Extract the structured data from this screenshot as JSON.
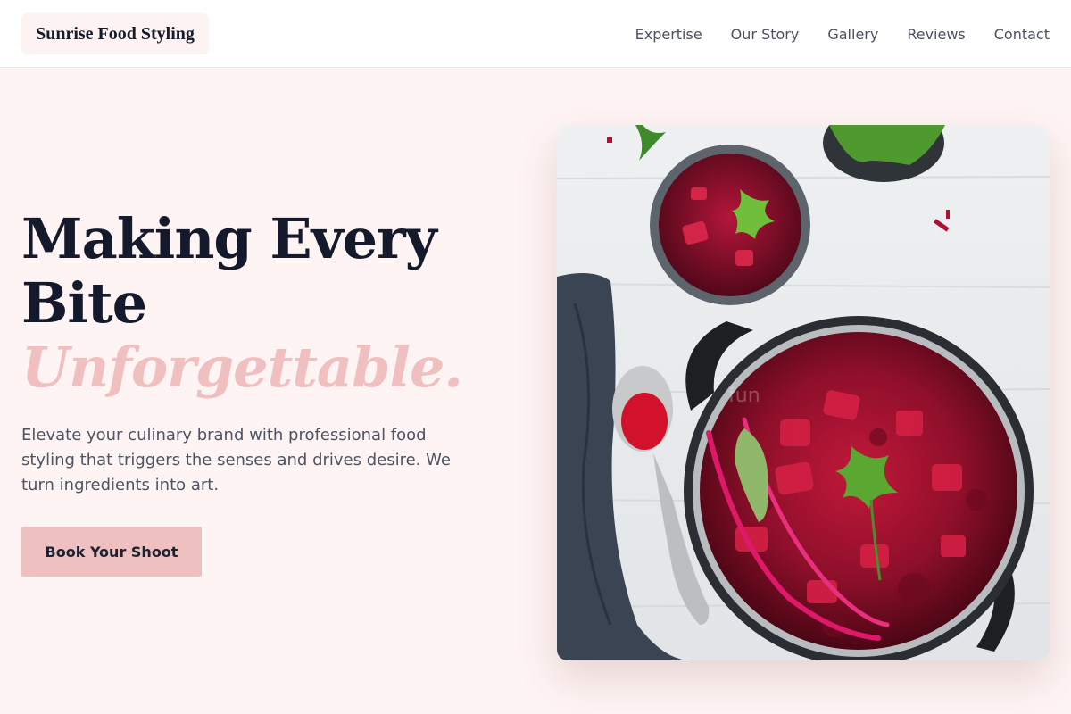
{
  "header": {
    "brand": "Sunrise Food Styling",
    "nav": [
      {
        "label": "Expertise"
      },
      {
        "label": "Our Story"
      },
      {
        "label": "Gallery"
      },
      {
        "label": "Reviews"
      },
      {
        "label": "Contact"
      }
    ]
  },
  "hero": {
    "title_line1": "Making Every",
    "title_line2": "Bite",
    "title_accent": "Unforgettable.",
    "subtitle": "Elevate your culinary brand with professional food styling that triggers the senses and drives desire. We turn ingredients into art.",
    "cta_label": "Book Your Shoot"
  },
  "colors": {
    "background": "#fef4f3",
    "accent_pink": "#efc0c0",
    "heading": "#141a2c"
  }
}
